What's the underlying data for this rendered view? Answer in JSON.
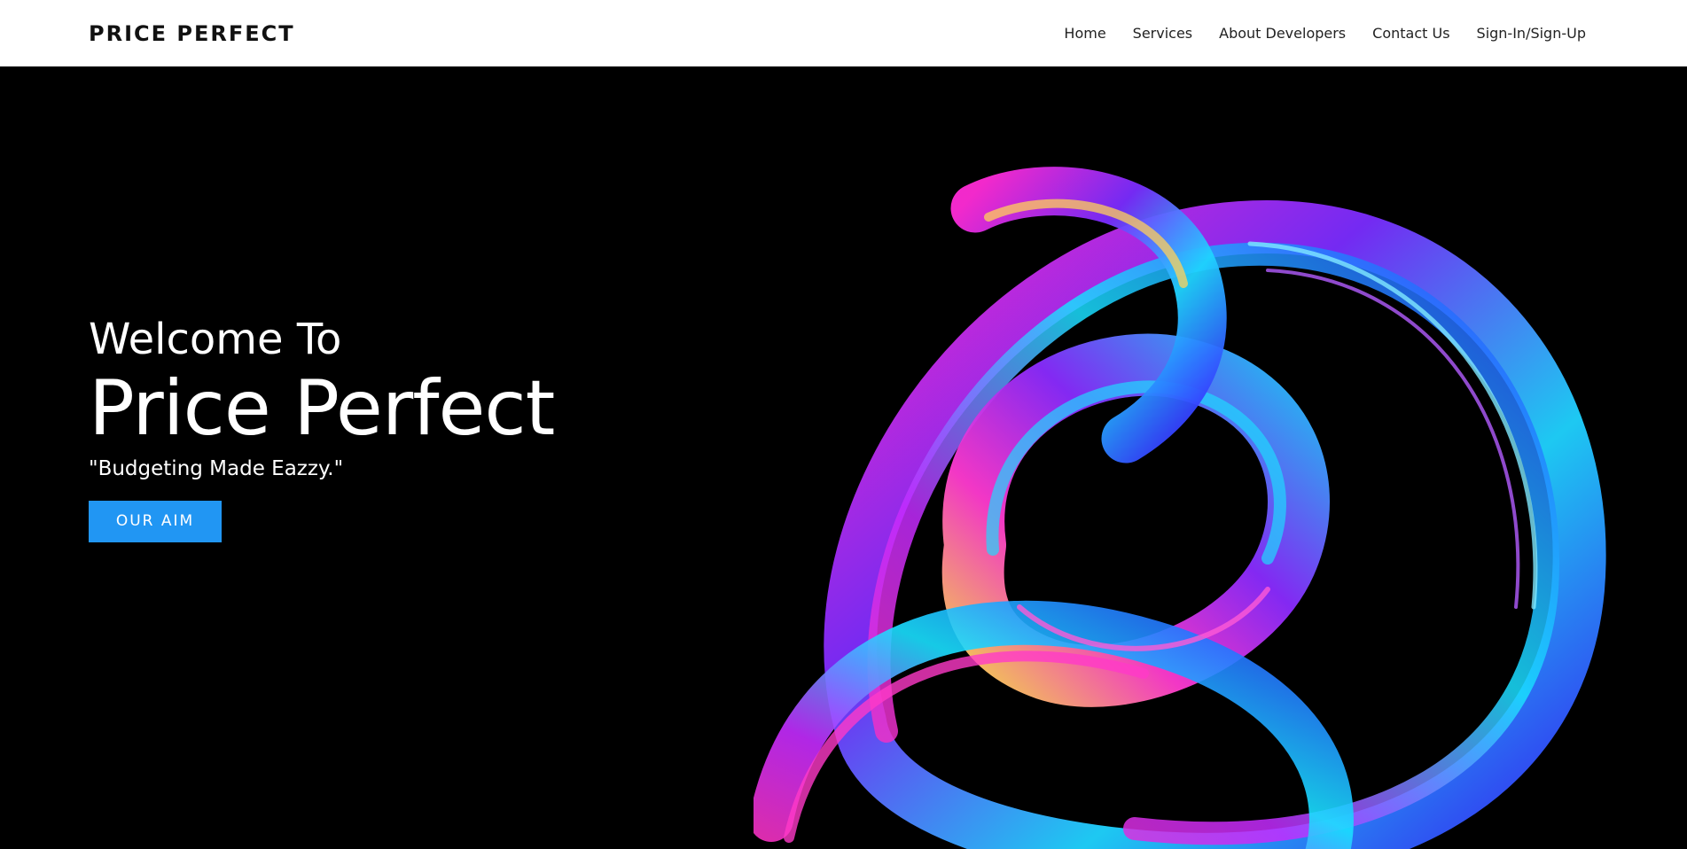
{
  "navbar": {
    "brand": "PRICE PERFECT",
    "links": [
      {
        "label": "Home"
      },
      {
        "label": "Services"
      },
      {
        "label": "About Developers"
      },
      {
        "label": "Contact Us"
      },
      {
        "label": "Sign-In/Sign-Up"
      }
    ]
  },
  "hero": {
    "welcome": "Welcome To",
    "title": "Price Perfect",
    "tagline": "\"Budgeting Made Eazzy.\"",
    "button_label": "OUR AIM"
  },
  "colors": {
    "accent": "#2196f3",
    "background": "#000000",
    "navbar": "#ffffff"
  },
  "icons": {
    "hero_art": "abstract-swirl-graphic"
  }
}
